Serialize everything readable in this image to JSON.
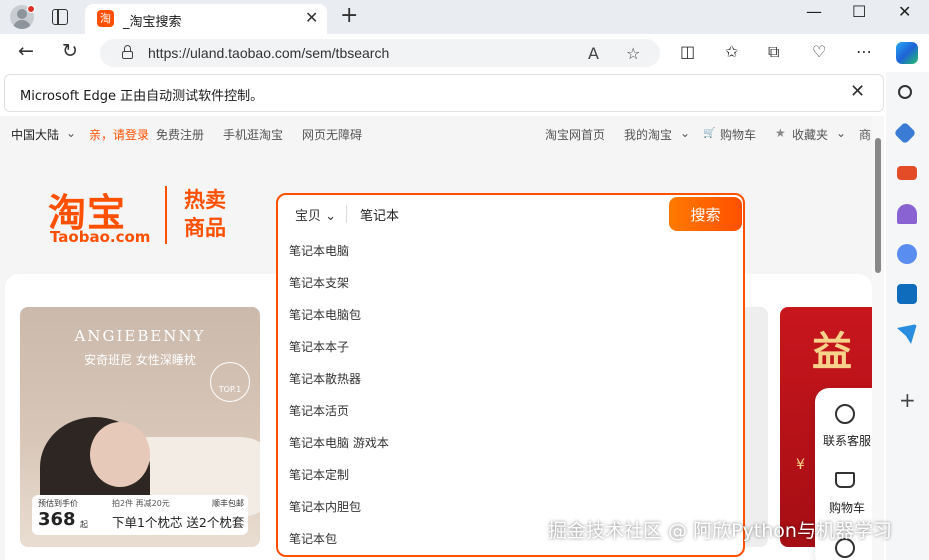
{
  "browser": {
    "tab_title": "_淘宝搜索",
    "tab_favicon": "淘",
    "url": "https://uland.taobao.com/sem/tbsearch",
    "infobar_text": "Microsoft Edge 正由自动测试软件控制。",
    "icons": {
      "new_tab": "+",
      "minimize": "—",
      "maximize": "☐",
      "close": "✕",
      "back": "←",
      "refresh": "↻",
      "read_aloud": "A",
      "favorite": "☆",
      "split": "◫",
      "favorites": "✩",
      "collections": "⧉",
      "wallet": "♡",
      "more": "⋯",
      "infobar_close": "✕",
      "sidebar_add": "+"
    }
  },
  "site_nav": {
    "region": "中国大陆",
    "region_arrow": "⌄",
    "greeting": "亲，请登录",
    "register": "免费注册",
    "mobile": "手机逛淘宝",
    "accessible": "网页无障碍",
    "home": "淘宝网首页",
    "my_taobao": "我的淘宝",
    "my_arrow": "⌄",
    "cart_icon": "🛒",
    "cart": "购物车",
    "fav_icon": "★",
    "favorites": "收藏夹",
    "fav_arrow": "⌄",
    "more": "商"
  },
  "logo": {
    "cn": "淘宝",
    "en": "Taobao.com",
    "slogan": "热卖商品"
  },
  "search": {
    "category": "宝贝",
    "category_arrow": "⌄",
    "query": "笔记本",
    "button": "搜索",
    "suggestions": [
      "笔记本电脑",
      "笔记本支架",
      "笔记本电脑包",
      "笔记本本子",
      "笔记本散热器",
      "笔记本活页",
      "笔记本电脑 游戏本",
      "笔记本定制",
      "笔记本内胆包",
      "笔记本包"
    ]
  },
  "banner1": {
    "brand": "ANGIEBENNY",
    "subtitle": "安奇班尼 女性深睡枕",
    "badge": "TOP.1",
    "price_label": "预估到手价",
    "price": "368",
    "price_unit": "起",
    "promo_top": "拍2件 再减20元",
    "shipping": "顺丰包邮",
    "promo": "下单1个枕芯 送2个枕套"
  },
  "banner_red": {
    "char": "益",
    "yen": "¥"
  },
  "service": {
    "support": "联系客服",
    "cart": "购物车"
  },
  "watermark": "掘金技术社区 @ 阿欣Python与机器学习"
}
